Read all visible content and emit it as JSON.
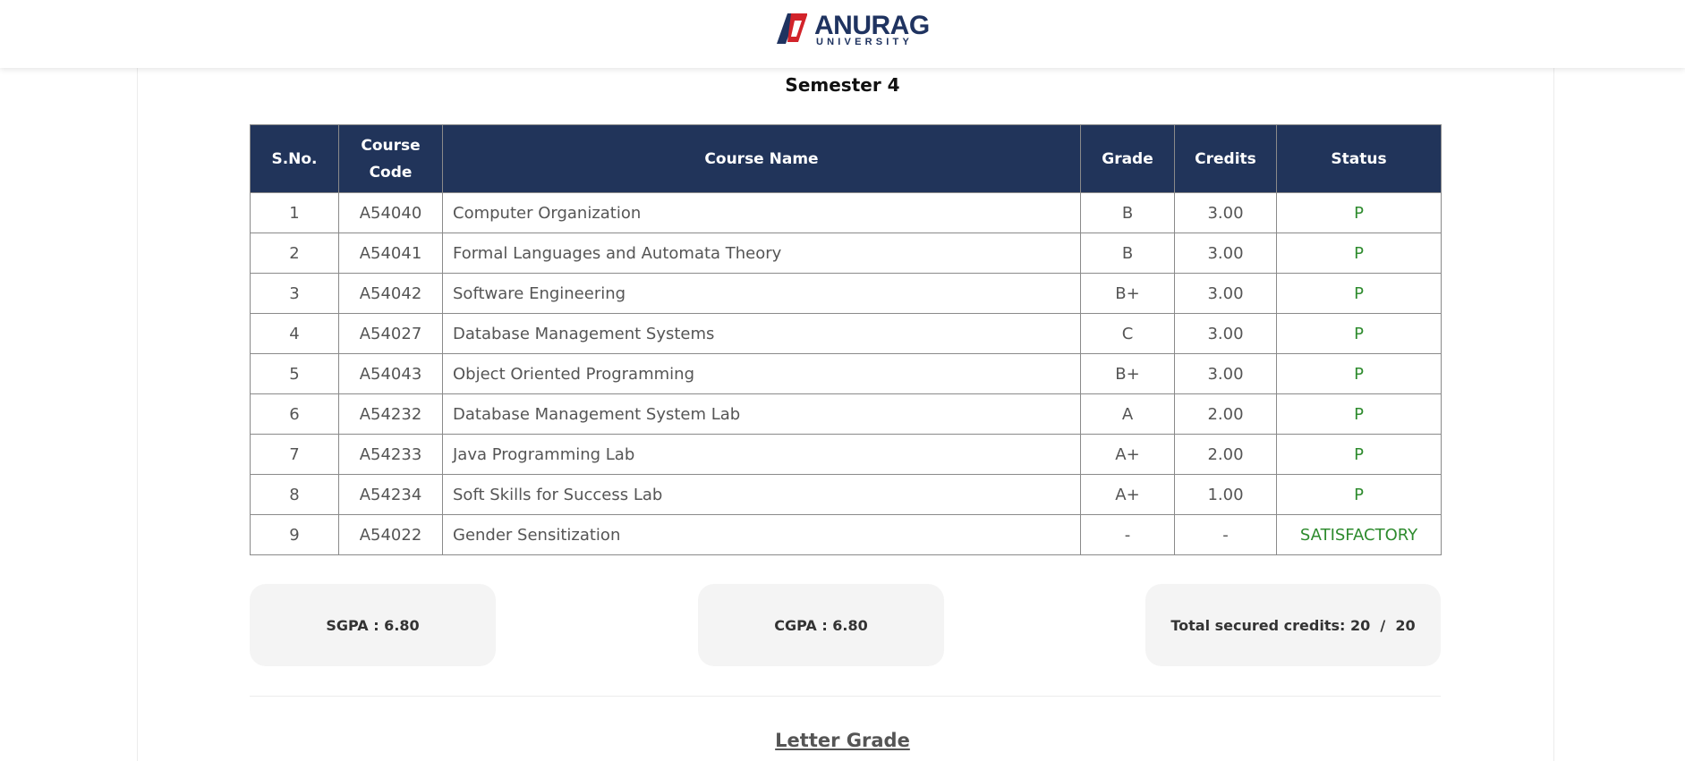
{
  "header": {
    "logo_word": "ANURAG",
    "logo_sub": "UNIVERSITY"
  },
  "semester_title": "Semester 4",
  "table": {
    "columns": [
      "S.No.",
      "Course Code",
      "Course Name",
      "Grade",
      "Credits",
      "Status"
    ],
    "rows": [
      {
        "sno": "1",
        "code": "A54040",
        "name": "Computer Organization",
        "grade": "B",
        "credits": "3.00",
        "status": "P"
      },
      {
        "sno": "2",
        "code": "A54041",
        "name": "Formal Languages and Automata Theory",
        "grade": "B",
        "credits": "3.00",
        "status": "P"
      },
      {
        "sno": "3",
        "code": "A54042",
        "name": "Software Engineering",
        "grade": "B+",
        "credits": "3.00",
        "status": "P"
      },
      {
        "sno": "4",
        "code": "A54027",
        "name": "Database Management Systems",
        "grade": "C",
        "credits": "3.00",
        "status": "P"
      },
      {
        "sno": "5",
        "code": "A54043",
        "name": "Object Oriented Programming",
        "grade": "B+",
        "credits": "3.00",
        "status": "P"
      },
      {
        "sno": "6",
        "code": "A54232",
        "name": "Database Management System Lab",
        "grade": "A",
        "credits": "2.00",
        "status": "P"
      },
      {
        "sno": "7",
        "code": "A54233",
        "name": "Java Programming Lab",
        "grade": "A+",
        "credits": "2.00",
        "status": "P"
      },
      {
        "sno": "8",
        "code": "A54234",
        "name": "Soft Skills for Success Lab",
        "grade": "A+",
        "credits": "1.00",
        "status": "P"
      },
      {
        "sno": "9",
        "code": "A54022",
        "name": "Gender Sensitization",
        "grade": "-",
        "credits": "-",
        "status": "SATISFACTORY"
      }
    ]
  },
  "summary": {
    "sgpa": "SGPA : 6.80",
    "cgpa": "CGPA : 6.80",
    "credits": "Total secured credits: 20  /  20"
  },
  "letter_grade_heading": "Letter Grade",
  "colors": {
    "header_bg": "#21345a",
    "status_green": "#2e8b2e",
    "logo_red": "#d2232a",
    "logo_navy": "#1f3360"
  }
}
